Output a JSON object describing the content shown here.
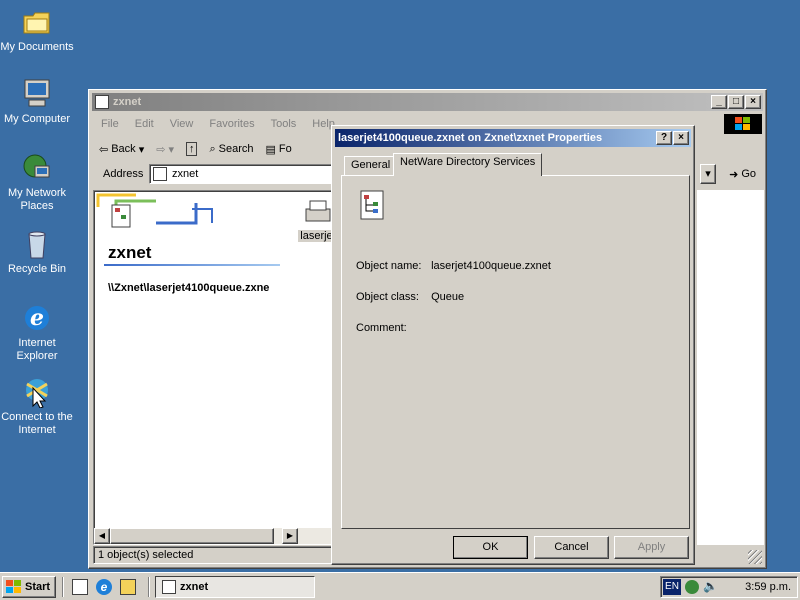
{
  "desktop": {
    "icons": [
      {
        "label": "My Documents"
      },
      {
        "label": "My Computer"
      },
      {
        "label": "My Network Places"
      },
      {
        "label": "Recycle Bin"
      },
      {
        "label": "Internet Explorer"
      },
      {
        "label": "Connect to the Internet"
      }
    ]
  },
  "explorer": {
    "title": "zxnet",
    "menu": [
      "File",
      "Edit",
      "View",
      "Favorites",
      "Tools",
      "Help"
    ],
    "toolbar": {
      "back": "Back",
      "search": "Search",
      "folders": "Fo"
    },
    "address_label": "Address",
    "address_value": "zxnet",
    "go_label": "Go",
    "folder_title": "zxnet",
    "path_text": "\\\\Zxnet\\laserjet4100queue.zxne",
    "item_label": "laserjet",
    "status": "1 object(s) selected"
  },
  "dialog": {
    "title": "laserjet4100queue.zxnet on Zxnet\\zxnet Properties",
    "help_btn": "?",
    "close_btn": "X",
    "tabs": [
      "General",
      "NetWare Directory Services"
    ],
    "fields": [
      {
        "label": "Object name:",
        "value": "laserjet4100queue.zxnet"
      },
      {
        "label": "Object class:",
        "value": "Queue"
      },
      {
        "label": "Comment:",
        "value": ""
      }
    ],
    "buttons": {
      "ok": "OK",
      "cancel": "Cancel",
      "apply": "Apply"
    }
  },
  "taskbar": {
    "start": "Start",
    "task": "zxnet",
    "lang": "EN",
    "clock": "3:59 p.m."
  },
  "colors": {
    "desktop": "#3a6ea5",
    "face": "#d4d0c8",
    "active_title": "#0a246a",
    "inactive_title": "#808080"
  }
}
